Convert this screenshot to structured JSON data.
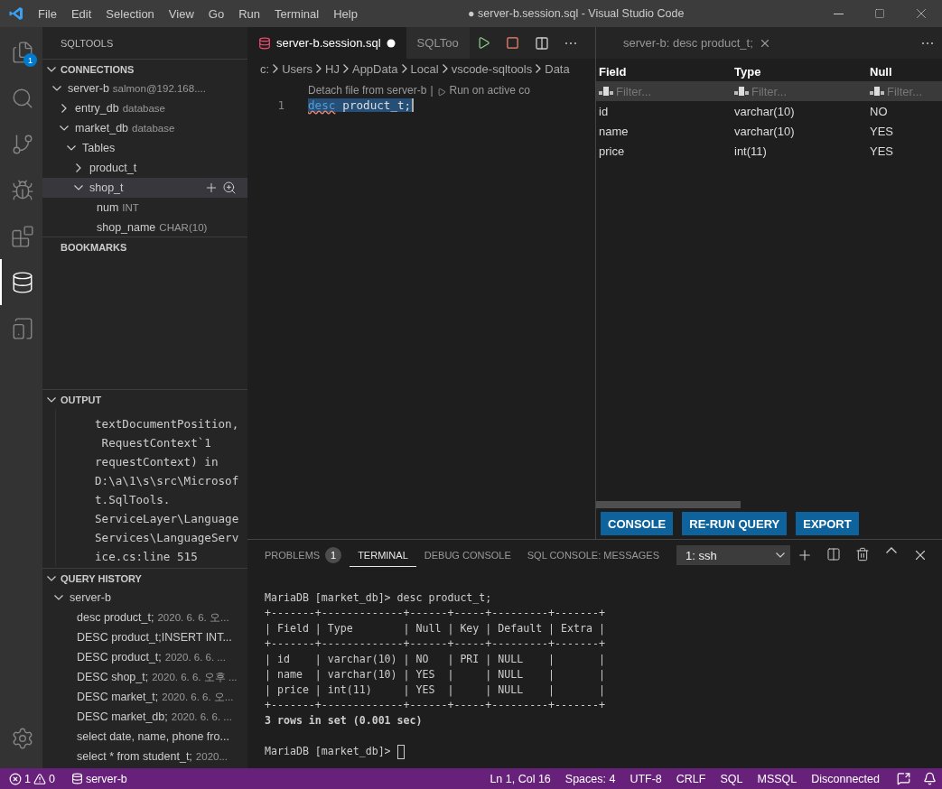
{
  "title_bar": {
    "menu": [
      "File",
      "Edit",
      "Selection",
      "View",
      "Go",
      "Run",
      "Terminal",
      "Help"
    ],
    "title": "● server-b.session.sql - Visual Studio Code"
  },
  "activity_bar": {
    "items": [
      {
        "kind": "explorer",
        "selected": false,
        "badge": "1"
      },
      {
        "kind": "search",
        "selected": false
      },
      {
        "kind": "source_control",
        "selected": false
      },
      {
        "kind": "debug",
        "selected": false
      },
      {
        "kind": "extensions",
        "selected": false
      },
      {
        "kind": "database",
        "selected": true
      },
      {
        "kind": "notebook",
        "selected": false
      },
      {
        "kind": "settings",
        "selected": false
      }
    ]
  },
  "sidebar": {
    "title": "SQLTOOLS",
    "sections": [
      {
        "kind": "connections",
        "title": "CONNECTIONS",
        "expanded": true,
        "tree": [
          {
            "label": "server-b",
            "detail": "salmon@192.168....",
            "expanded": true,
            "selected": false,
            "children": [
              {
                "label": "entry_db",
                "detail": "database",
                "expanded": false,
                "selected": false
              },
              {
                "label": "market_db",
                "detail": "database",
                "expanded": true,
                "selected": false,
                "children": [
                  {
                    "label": "Tables",
                    "expanded": true,
                    "selected": false,
                    "children": [
                      {
                        "label": "product_t",
                        "expanded": false,
                        "selected": false
                      },
                      {
                        "label": "shop_t",
                        "expanded": true,
                        "selected": true,
                        "children": [
                          {
                            "label": "num",
                            "detail": "INT",
                            "selected": false
                          },
                          {
                            "label": "shop_name",
                            "detail": "CHAR(10)",
                            "selected": false
                          }
                        ]
                      }
                    ]
                  }
                ]
              }
            ]
          }
        ]
      },
      {
        "kind": "bookmarks",
        "title": "BOOKMARKS"
      },
      {
        "kind": "output",
        "title": "OUTPUT",
        "expanded": true,
        "lines": [
          "textDocumentPosition,",
          " RequestContext`1",
          "requestContext) in",
          "D:\\a\\1\\s\\src\\Microsof",
          "t.SqlTools.",
          "ServiceLayer\\Language",
          "Services\\LanguageServ",
          "ice.cs:line 515"
        ]
      },
      {
        "kind": "history",
        "title": "QUERY HISTORY",
        "expanded": true,
        "tree": [
          {
            "label": "server-b",
            "expanded": true,
            "selected": false,
            "children": [
              {
                "label": "desc product_t;",
                "detail": "2020. 6. 6. 오...",
                "selected": false
              },
              {
                "label": "DESC product_t;INSERT INT...",
                "selected": false
              },
              {
                "label": "DESC product_t;",
                "detail": "2020. 6. 6. ...",
                "selected": false
              },
              {
                "label": "DESC shop_t;",
                "detail": "2020. 6. 6. 오후 ...",
                "selected": false
              },
              {
                "label": "DESC market_t;",
                "detail": "2020. 6. 6. 오...",
                "selected": false
              },
              {
                "label": "DESC market_db;",
                "detail": "2020. 6. 6. ...",
                "selected": false
              },
              {
                "label": "select date, name, phone fro...",
                "selected": false
              },
              {
                "label": "select * from student_t;",
                "detail": "2020...",
                "selected": false
              }
            ]
          }
        ]
      }
    ]
  },
  "editor": {
    "tabs": [
      {
        "label": "server-b.session.sql",
        "selected": true,
        "dirty": true
      },
      {
        "label": "SQLToo",
        "selected": false,
        "dirty": false
      }
    ],
    "breadcrumb": [
      "c:",
      "Users",
      "HJ",
      "AppData",
      "Local",
      "vscode-sqltools",
      "Data"
    ],
    "codelens": {
      "links": [
        "Detach file from server-b",
        "Run on active co"
      ],
      "separator": "|"
    },
    "lines": [
      {
        "number": "1",
        "keyword": "desc",
        "rest": "product_t;"
      }
    ]
  },
  "results": {
    "tab": "server-b: desc product_t;",
    "columns": [
      {
        "label": "Field",
        "placeholder": "Filter..."
      },
      {
        "label": "Type",
        "placeholder": "Filter..."
      },
      {
        "label": "Null",
        "placeholder": "Filter..."
      }
    ],
    "rows": [
      [
        "id",
        "varchar(10)",
        "NO"
      ],
      [
        "name",
        "varchar(10)",
        "YES"
      ],
      [
        "price",
        "int(11)",
        "YES"
      ]
    ],
    "buttons": [
      "CONSOLE",
      "RE-RUN QUERY",
      "EXPORT"
    ]
  },
  "panel": {
    "tabs": [
      {
        "label": "PROBLEMS",
        "badge": "1",
        "selected": false
      },
      {
        "label": "TERMINAL",
        "selected": true
      },
      {
        "label": "DEBUG CONSOLE",
        "selected": false
      },
      {
        "label": "SQL CONSOLE: MESSAGES",
        "selected": false
      }
    ],
    "terminal_select": "1: ssh",
    "lines": [
      {
        "text": "MariaDB [market_db]> desc product_t;",
        "bold": false
      },
      {
        "text": "+-------+-------------+------+-----+---------+-------+",
        "bold": false
      },
      {
        "text": "| Field | Type        | Null | Key | Default | Extra |",
        "bold": false
      },
      {
        "text": "+-------+-------------+------+-----+---------+-------+",
        "bold": false
      },
      {
        "text": "| id    | varchar(10) | NO   | PRI | NULL    |       |",
        "bold": false
      },
      {
        "text": "| name  | varchar(10) | YES  |     | NULL    |       |",
        "bold": false
      },
      {
        "text": "| price | int(11)     | YES  |     | NULL    |       |",
        "bold": false
      },
      {
        "text": "+-------+-------------+------+-----+---------+-------+",
        "bold": false
      },
      {
        "text": "3 rows in set (0.001 sec)",
        "bold": true
      },
      {
        "text": "MariaDB [market_db]>",
        "bold": false,
        "space_before": true,
        "cursor": true
      }
    ]
  },
  "status_bar": {
    "errors": "1",
    "warnings": "0",
    "connection": "server-b",
    "items": [
      "Ln 1, Col 16",
      "Spaces: 4",
      "UTF-8",
      "CRLF",
      "SQL",
      "MSSQL",
      "Disconnected"
    ]
  }
}
